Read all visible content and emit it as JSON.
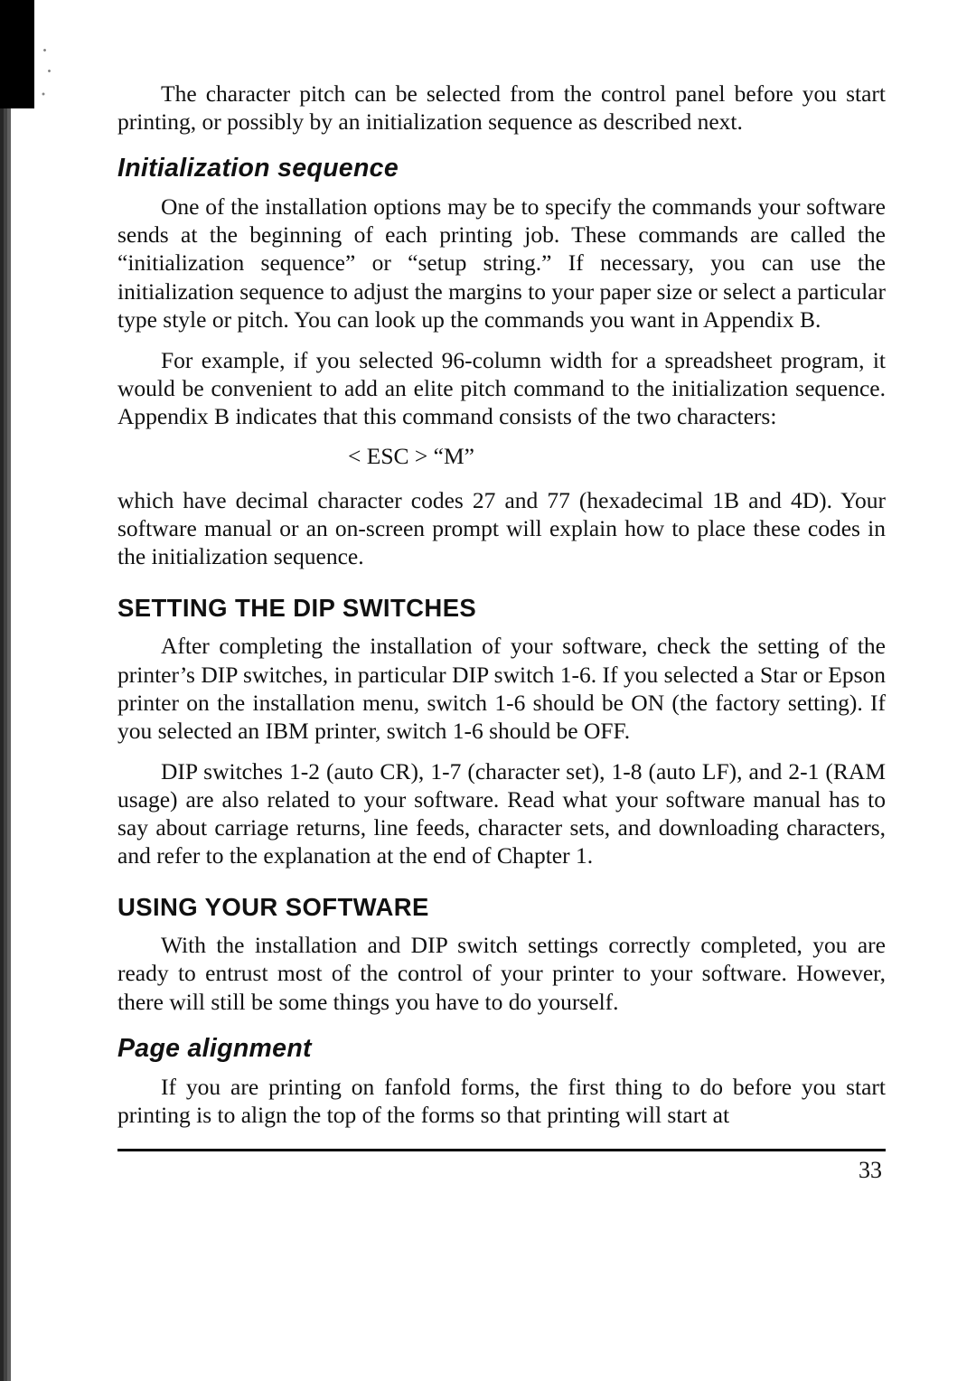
{
  "intro": {
    "para1": "The character pitch can be selected from the control panel before you start printing, or possibly by an initialization sequence as described next."
  },
  "init_seq": {
    "heading": "Initialization sequence",
    "para1": "One of the installation options may be to specify the commands your software sends at the beginning of each printing job. These commands are called the “initialization sequence” or “setup string.” If necessary, you can use the initialization sequence to adjust the margins to your paper size or select a particular type style or pitch. You can look up the commands you want in Appendix B.",
    "para2": "For example, if you selected 96-column width for a spreadsheet program, it would be convenient to add an elite pitch command to the initialization sequence. Appendix B indicates that this command consists of the two characters:",
    "code": "< ESC >  “M”",
    "para3": "which have decimal character codes 27 and 77 (hexadecimal 1B and 4D). Your software manual or an on-screen prompt will explain how to place these codes in the initialization sequence."
  },
  "dip": {
    "heading": "SETTING THE DIP SWITCHES",
    "para1": "After completing the installation of your software, check the setting of the printer’s DIP switches, in particular DIP switch 1-6. If you selected a Star or Epson printer on the installation menu, switch 1-6 should be ON (the factory setting). If you selected an IBM printer, switch 1-6 should be OFF.",
    "para2": "DIP switches 1-2 (auto CR), 1-7 (character set), 1-8 (auto LF), and 2-1 (RAM usage) are also related to your software. Read what your software manual has to say about carriage returns, line feeds, character sets, and downloading characters, and refer to the explanation at the end of Chapter 1."
  },
  "using": {
    "heading": "USING YOUR SOFTWARE",
    "para1": "With the installation and DIP switch settings correctly completed, you are ready to entrust most of the control of your printer to your software. However, there will still be some things you have to do yourself."
  },
  "page_align": {
    "heading": "Page alignment",
    "para1": "If you are printing on fanfold forms, the first thing to do before you start printing is to align the top of the forms so that printing will start at"
  },
  "page_number": "33"
}
